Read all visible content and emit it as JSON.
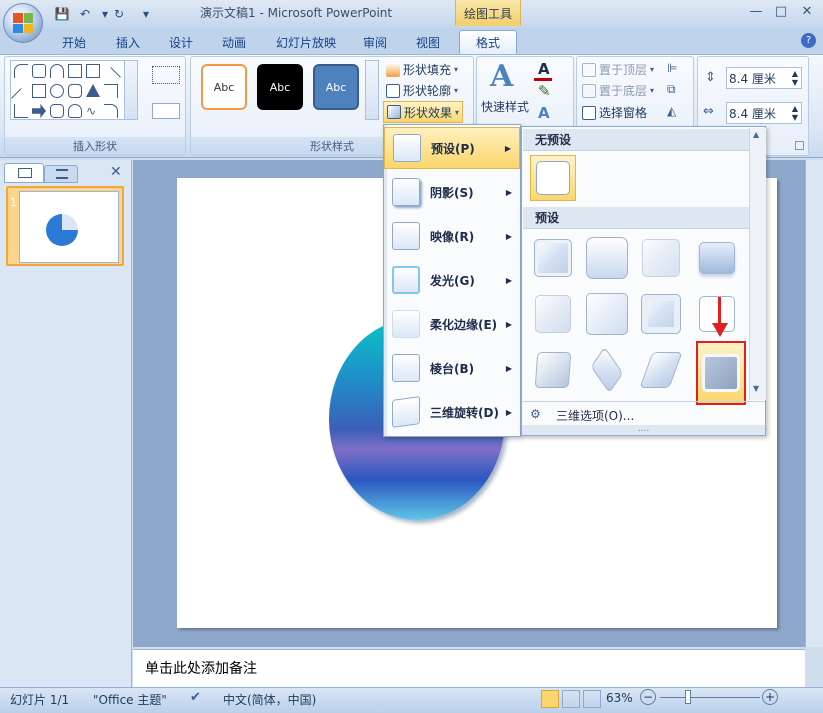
{
  "window": {
    "title": "演示文稿1 - Microsoft PowerPoint",
    "context_tab": "绘图工具",
    "controls": {
      "minimize": "—",
      "maximize": "□",
      "close": "✕"
    }
  },
  "quick_access": {
    "save": "💾",
    "undo": "↶",
    "redo": "↻",
    "customize": "▾"
  },
  "tabs": [
    {
      "label": "开始"
    },
    {
      "label": "插入"
    },
    {
      "label": "设计"
    },
    {
      "label": "动画"
    },
    {
      "label": "幻灯片放映"
    },
    {
      "label": "审阅"
    },
    {
      "label": "视图"
    },
    {
      "label": "格式"
    }
  ],
  "help_label": "?",
  "ribbon": {
    "insert_shapes_label": "插入形状",
    "shape_styles_label": "形状样式",
    "style_swatches": [
      "Abc",
      "Abc",
      "Abc"
    ],
    "shape_fill": "形状填充",
    "shape_outline": "形状轮廓",
    "shape_effects": "形状效果",
    "quick_styles": "快速样式",
    "bring_front": "置于顶层",
    "send_back": "置于底层",
    "selection_pane": "选择窗格",
    "height_value": "8.4 厘米",
    "width_value": "8.4 厘米"
  },
  "effects_menu": {
    "items": [
      {
        "label": "预设(P)"
      },
      {
        "label": "阴影(S)"
      },
      {
        "label": "映像(R)"
      },
      {
        "label": "发光(G)"
      },
      {
        "label": "柔化边缘(E)"
      },
      {
        "label": "棱台(B)"
      },
      {
        "label": "三维旋转(D)"
      }
    ]
  },
  "preset_menu": {
    "no_preset_header": "无预设",
    "preset_header": "预设",
    "options_label": "三维选项(O)...",
    "resize_grip": "....",
    "scroll_up": "▲",
    "scroll_down": "▼"
  },
  "slides_pane": {
    "slide_number": "1"
  },
  "notes_placeholder": "单击此处添加备注",
  "status": {
    "slide": "幻灯片 1/1",
    "theme": "\"Office 主题\"",
    "language": "中文(简体，中国)",
    "zoom": "63%",
    "zoom_out": "−",
    "zoom_in": "+"
  },
  "colors": {
    "accent": "#f3cf6b",
    "highlight_red": "#e02020",
    "ribbon_blue": "#15428b"
  }
}
